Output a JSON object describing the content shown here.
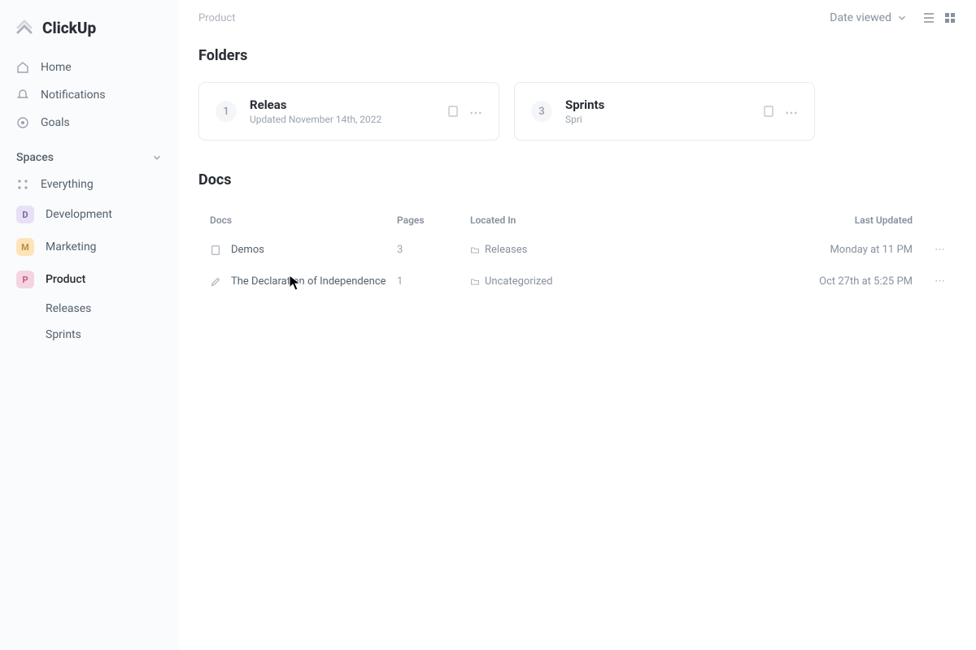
{
  "brand": {
    "name": "ClickUp"
  },
  "sidebar": {
    "nav": [
      {
        "label": "Home",
        "icon": "home"
      },
      {
        "label": "Notifications",
        "icon": "bell"
      },
      {
        "label": "Goals",
        "icon": "target"
      }
    ],
    "spaces_header": "Spaces",
    "spaces": [
      {
        "label": "Everything",
        "badge": "∷",
        "cls": "badge-everything"
      },
      {
        "label": "Development",
        "badge": "D",
        "cls": "badge-dev"
      },
      {
        "label": "Marketing",
        "badge": "M",
        "cls": "badge-mkt"
      },
      {
        "label": "Product",
        "badge": "P",
        "cls": "badge-prd",
        "active": true
      }
    ],
    "sub_items": [
      {
        "label": "Releases"
      },
      {
        "label": "Sprints"
      }
    ]
  },
  "breadcrumb": "Product",
  "sort": {
    "label": "Date viewed"
  },
  "sections": {
    "folders_title": "Folders",
    "docs_title": "Docs"
  },
  "folders": [
    {
      "num": "1",
      "name": "Releas",
      "date": "Updated November 14th, 2022"
    },
    {
      "num": "3",
      "name": "Sprints",
      "date": "Spri"
    }
  ],
  "docs_header": {
    "doc": "Docs",
    "pages": "Pages",
    "located": "Located In",
    "updated": "Last Updated"
  },
  "docs": [
    {
      "name": "Demos",
      "pages": "3",
      "loc": "Releases",
      "updated": "Monday at 11 PM",
      "icon": "doc"
    },
    {
      "name": "The Declaration of Independence",
      "pages": "1",
      "loc": "Uncategorized",
      "updated": "Oct 27th at 5:25 PM",
      "icon": "pen"
    }
  ]
}
